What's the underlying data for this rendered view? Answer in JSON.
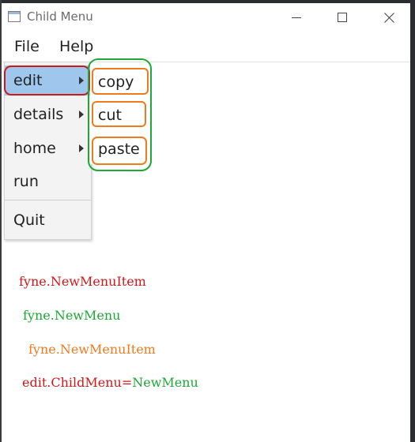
{
  "window": {
    "title": "Child Menu",
    "controls": {
      "minimize": "minimize-icon",
      "maximize": "maximize-icon",
      "close": "close-icon"
    }
  },
  "menubar": {
    "items": [
      {
        "label": "File"
      },
      {
        "label": "Help"
      }
    ]
  },
  "dropdown": {
    "items": [
      {
        "label": "edit",
        "has_submenu": true,
        "highlighted": true
      },
      {
        "label": "details",
        "has_submenu": true
      },
      {
        "label": "home",
        "has_submenu": true
      },
      {
        "label": "run",
        "has_submenu": false
      },
      {
        "label": "Quit",
        "has_submenu": false
      }
    ]
  },
  "submenu": {
    "items": [
      {
        "label": "copy"
      },
      {
        "label": "cut"
      },
      {
        "label": "paste"
      }
    ]
  },
  "annotations": {
    "line1": "fyne.NewMenuItem",
    "line2": "fyne.NewMenu",
    "line3": "fyne.NewMenuItem",
    "line4_part1": "edit.ChildMenu=",
    "line4_part2": "NewMenu"
  },
  "colors": {
    "highlight": "#9fc7ee",
    "annotation_red": "#d01818",
    "annotation_green": "#1ea836",
    "annotation_orange": "#f07a20"
  }
}
